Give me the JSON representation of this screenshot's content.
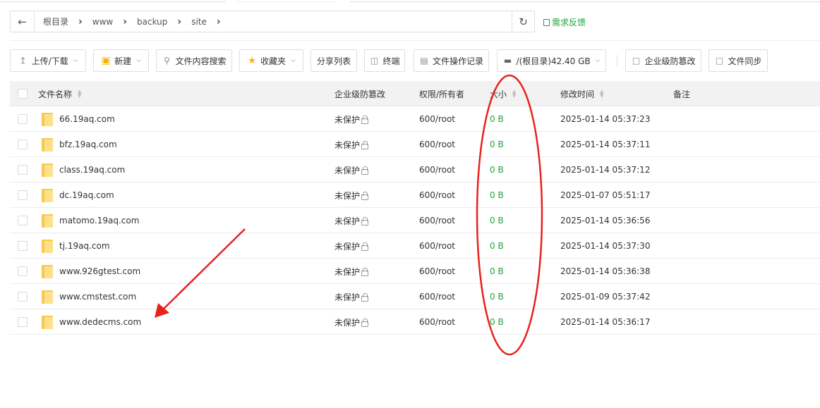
{
  "pathbar": {
    "back_icon": "arrow-left-icon",
    "crumbs": [
      "根目录",
      "www",
      "backup",
      "site"
    ],
    "refresh_icon": "refresh-icon"
  },
  "feedback": {
    "label": "需求反馈"
  },
  "toolbar": {
    "upload_download": "上传/下载",
    "new": "新建",
    "content_search": "文件内容搜索",
    "favorites": "收藏夹",
    "share_list": "分享列表",
    "terminal": "终端",
    "file_log": "文件操作记录",
    "disk": "/(根目录)42.40 GB",
    "tamper": "企业级防篡改",
    "sync": "文件同步"
  },
  "table": {
    "headers": {
      "name": "文件名称",
      "tamper": "企业级防篡改",
      "perm": "权限/所有者",
      "size": "大小",
      "mtime": "修改时间",
      "note": "备注"
    },
    "rows": [
      {
        "name": "66.19aq.com",
        "tamper": "未保护",
        "perm": "600/root",
        "size": "0 B",
        "mtime": "2025-01-14 05:37:23",
        "note": ""
      },
      {
        "name": "bfz.19aq.com",
        "tamper": "未保护",
        "perm": "600/root",
        "size": "0 B",
        "mtime": "2025-01-14 05:37:11",
        "note": ""
      },
      {
        "name": "class.19aq.com",
        "tamper": "未保护",
        "perm": "600/root",
        "size": "0 B",
        "mtime": "2025-01-14 05:37:12",
        "note": ""
      },
      {
        "name": "dc.19aq.com",
        "tamper": "未保护",
        "perm": "600/root",
        "size": "0 B",
        "mtime": "2025-01-07 05:51:17",
        "note": ""
      },
      {
        "name": "matomo.19aq.com",
        "tamper": "未保护",
        "perm": "600/root",
        "size": "0 B",
        "mtime": "2025-01-14 05:36:56",
        "note": ""
      },
      {
        "name": "tj.19aq.com",
        "tamper": "未保护",
        "perm": "600/root",
        "size": "0 B",
        "mtime": "2025-01-14 05:37:30",
        "note": ""
      },
      {
        "name": "www.926gtest.com",
        "tamper": "未保护",
        "perm": "600/root",
        "size": "0 B",
        "mtime": "2025-01-14 05:36:38",
        "note": ""
      },
      {
        "name": "www.cmstest.com",
        "tamper": "未保护",
        "perm": "600/root",
        "size": "0 B",
        "mtime": "2025-01-09 05:37:42",
        "note": ""
      },
      {
        "name": "www.dedecms.com",
        "tamper": "未保护",
        "perm": "600/root",
        "size": "0 B",
        "mtime": "2025-01-14 05:36:17",
        "note": ""
      }
    ]
  },
  "colors": {
    "accent_green": "#20a53a",
    "annotation_red": "#e8221c",
    "folder_yellow": "#f7c94f"
  }
}
